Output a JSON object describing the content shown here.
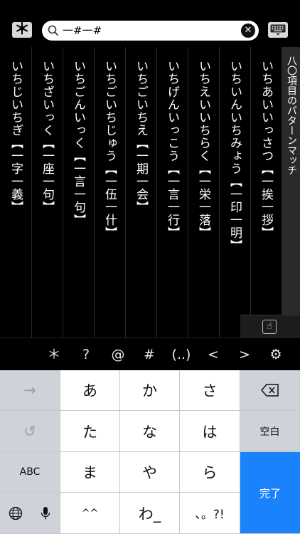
{
  "toolbar": {
    "menu_symbol": "＊",
    "search_value": "一#一#",
    "clear_symbol": "✕"
  },
  "results": [
    "いちあいいっさつ【一挨一拶】",
    "いちいんいちみょう【一印一明】",
    "いちえいいちらく【一栄一落】",
    "いちげんいっこう【一言一行】",
    "いちごいちえ【一期一会】",
    "いちごいちじゅう【一伍一什】",
    "いちごんいっく【一言一句】",
    "いちざいっく【一座一句】",
    "いちじいちぎ【一字一義】"
  ],
  "side_label": "八〇項目のパターンマッチ",
  "symbol_bar": [
    "＊",
    "?",
    "@",
    "#",
    "(..)",
    "<",
    ">",
    "⚙"
  ],
  "keyboard": {
    "row1": [
      "→",
      "あ",
      "か",
      "さ",
      "⌫"
    ],
    "row2": [
      "↺",
      "た",
      "な",
      "は",
      "空白"
    ],
    "row3": [
      "ABC",
      "ま",
      "や",
      "ら"
    ],
    "row4": [
      "🌐",
      "🎤",
      "^^",
      "わ_",
      "、。?!"
    ],
    "enter_label": "完了"
  },
  "colors": {
    "background": "#000000",
    "keyboard_gray": "#cfd2d8",
    "enter_blue": "#1a82fb"
  }
}
